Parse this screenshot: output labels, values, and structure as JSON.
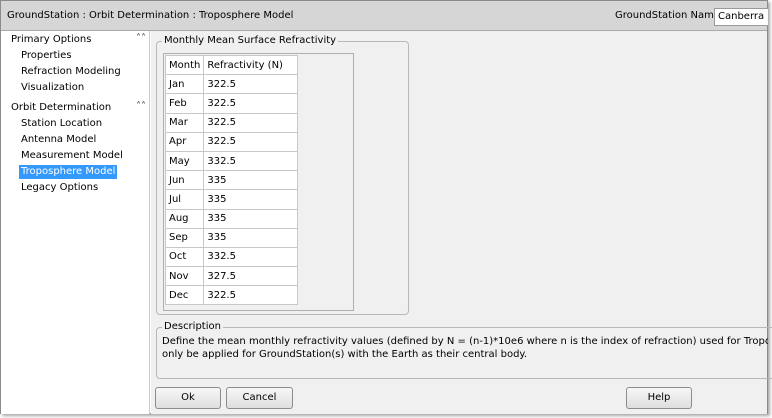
{
  "window": {
    "title": "GroundStation : Orbit Determination : Troposphere Model",
    "gs_name_label": "GroundStation Name",
    "gs_name_value": "Canberra"
  },
  "sidebar": {
    "sections": [
      {
        "label": "Primary Options",
        "chevron": "double-chevron-up-icon",
        "items": [
          "Properties",
          "Refraction Modeling",
          "Visualization"
        ]
      },
      {
        "label": "Orbit Determination",
        "chevron": "double-chevron-up-icon",
        "items": [
          "Station Location",
          "Antenna Model",
          "Measurement Model",
          "Troposphere Model",
          "Legacy Options"
        ]
      }
    ],
    "selected_item": "Troposphere Model"
  },
  "refractivity": {
    "group_title": "Monthly Mean Surface Refractivity",
    "columns": [
      "Month",
      "Refractivity (N)"
    ],
    "rows": [
      [
        "Jan",
        "322.5"
      ],
      [
        "Feb",
        "322.5"
      ],
      [
        "Mar",
        "322.5"
      ],
      [
        "Apr",
        "322.5"
      ],
      [
        "May",
        "332.5"
      ],
      [
        "Jun",
        "335"
      ],
      [
        "Jul",
        "335"
      ],
      [
        "Aug",
        "335"
      ],
      [
        "Sep",
        "335"
      ],
      [
        "Oct",
        "332.5"
      ],
      [
        "Nov",
        "327.5"
      ],
      [
        "Dec",
        "322.5"
      ]
    ]
  },
  "description": {
    "title": "Description",
    "line1": "Define the mean monthly refractivity values (defined by N = (n-1)*10e6 where n is the index of refraction) used for Tropospheric modeling.  Trop",
    "line2": "only be applied for GroundStation(s) with the Earth as their central body."
  },
  "buttons": {
    "ok": "Ok",
    "cancel": "Cancel",
    "help": "Help"
  },
  "colors": {
    "selection": "#3399ff",
    "header_bg": "#d6d6d6",
    "panel_bg": "#f0f0f0"
  }
}
